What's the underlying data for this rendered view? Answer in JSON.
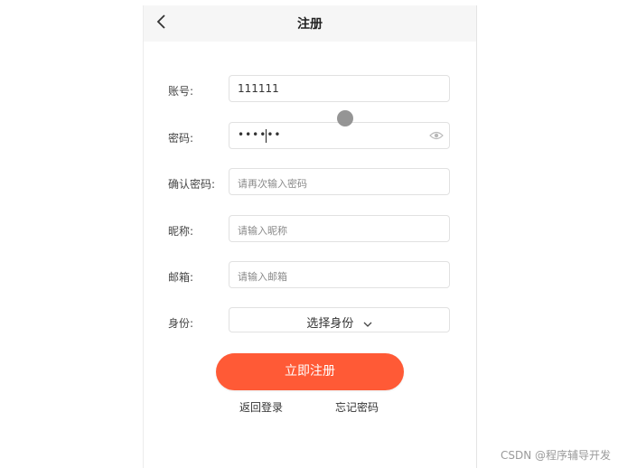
{
  "header": {
    "title": "注册"
  },
  "form": {
    "account": {
      "label": "账号:",
      "value": "111111"
    },
    "password": {
      "label": "密码:",
      "value": "••••••"
    },
    "confirm_password": {
      "label": "确认密码:",
      "placeholder": "请再次输入密码"
    },
    "nickname": {
      "label": "昵称:",
      "placeholder": "请输入昵称"
    },
    "email": {
      "label": "邮箱:",
      "placeholder": "请输入邮箱"
    },
    "identity": {
      "label": "身份:",
      "value": "选择身份"
    }
  },
  "actions": {
    "register": "立即注册",
    "back_login": "返回登录",
    "forgot_password": "忘记密码"
  },
  "watermark": "CSDN @程序辅导开发",
  "colors": {
    "accent": "#ff5a36",
    "navbar_bg": "#f6f6f6"
  },
  "icons": {
    "back": "chevron-left-icon",
    "eye": "eye-icon",
    "dropdown": "chevron-down-icon"
  }
}
